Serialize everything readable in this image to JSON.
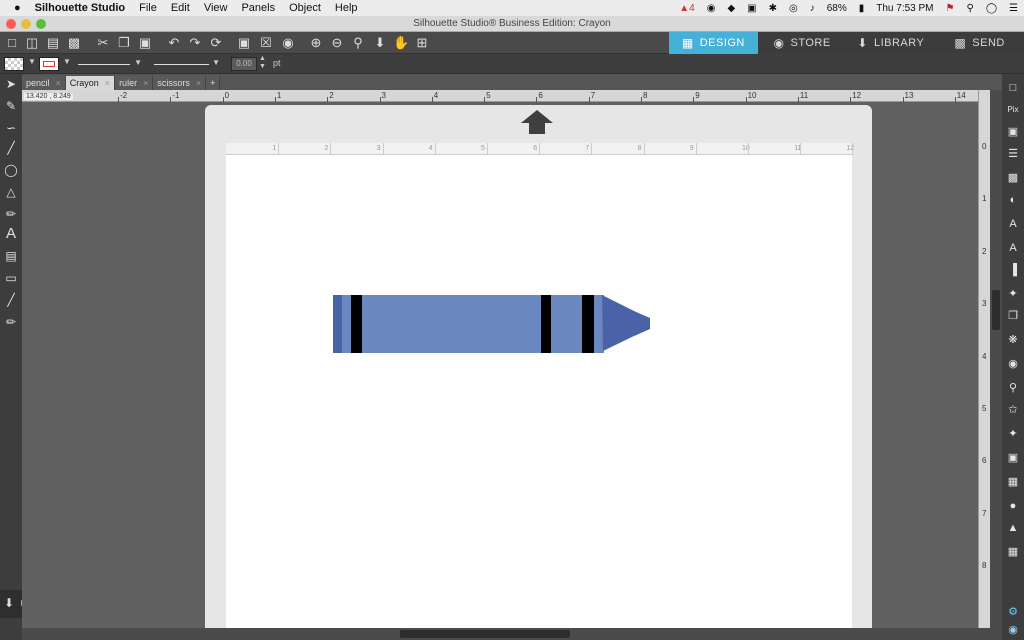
{
  "menubar": {
    "app_name": "Silhouette Studio",
    "items": [
      "File",
      "Edit",
      "View",
      "Panels",
      "Object",
      "Help"
    ],
    "status": {
      "alerts": "4",
      "battery": "68%",
      "clock": "Thu 7:53 PM"
    }
  },
  "window": {
    "title": "Silhouette Studio® Business Edition: Crayon"
  },
  "nav_tabs": [
    {
      "label": "DESIGN",
      "active": true
    },
    {
      "label": "STORE",
      "active": false
    },
    {
      "label": "LIBRARY",
      "active": false
    },
    {
      "label": "SEND",
      "active": false
    }
  ],
  "line_options": {
    "width_value": "0.00",
    "unit": "pt"
  },
  "doc_tabs": [
    {
      "label": "pencil"
    },
    {
      "label": "Crayon",
      "active": true
    },
    {
      "label": "ruler"
    },
    {
      "label": "scissors"
    }
  ],
  "coordinates": "13.420 , 8.249",
  "ruler_h": [
    "-2",
    "-1",
    "0",
    "1",
    "2",
    "3",
    "4",
    "5",
    "6",
    "7",
    "8",
    "9",
    "10",
    "11",
    "12",
    "13",
    "14"
  ],
  "ruler_mat": [
    "1",
    "2",
    "3",
    "4",
    "5",
    "6",
    "7",
    "8",
    "9",
    "10",
    "11",
    "12"
  ],
  "ruler_v": [
    "0",
    "1",
    "2",
    "3",
    "4",
    "5",
    "6",
    "7",
    "8"
  ],
  "colors": {
    "accent": "#45b1d8",
    "crayon_body": "#6b87c0",
    "crayon_tip": "#4a63a8",
    "crayon_band": "#000000"
  }
}
